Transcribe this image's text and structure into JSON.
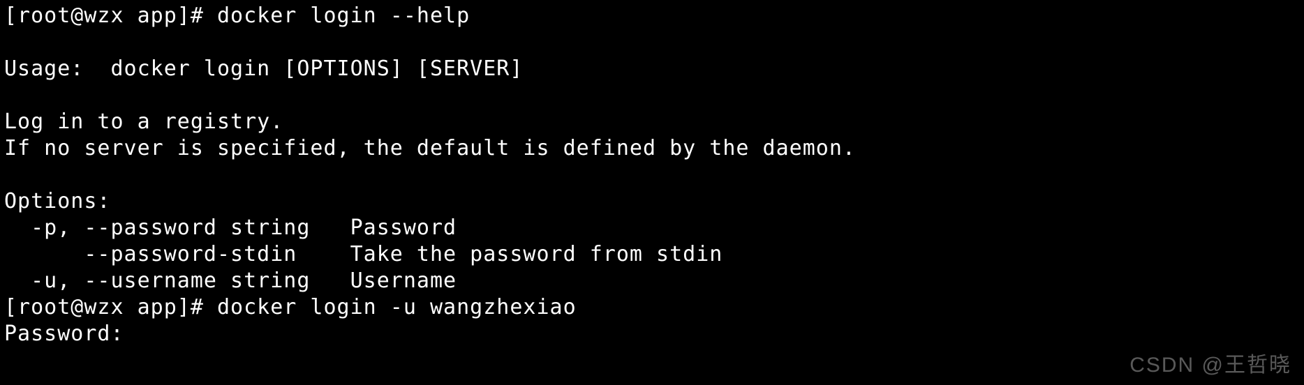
{
  "terminal": {
    "lines": [
      "[root@wzx app]# docker login --help",
      "",
      "Usage:  docker login [OPTIONS] [SERVER]",
      "",
      "Log in to a registry.",
      "If no server is specified, the default is defined by the daemon.",
      "",
      "Options:",
      "  -p, --password string   Password",
      "      --password-stdin    Take the password from stdin",
      "  -u, --username string   Username",
      "[root@wzx app]# docker login -u wangzhexiao",
      "Password: "
    ],
    "prompt1": "[root@wzx app]# ",
    "command1": "docker login --help",
    "usage_line": "Usage:  docker login [OPTIONS] [SERVER]",
    "desc_line1": "Log in to a registry.",
    "desc_line2": "If no server is specified, the default is defined by the daemon.",
    "options_header": "Options:",
    "opt_p": "  -p, --password string   Password",
    "opt_stdin": "      --password-stdin    Take the password from stdin",
    "opt_u": "  -u, --username string   Username",
    "prompt2": "[root@wzx app]# ",
    "command2": "docker login -u wangzhexiao",
    "password_prompt": "Password: "
  },
  "watermark": "CSDN @王哲晓"
}
